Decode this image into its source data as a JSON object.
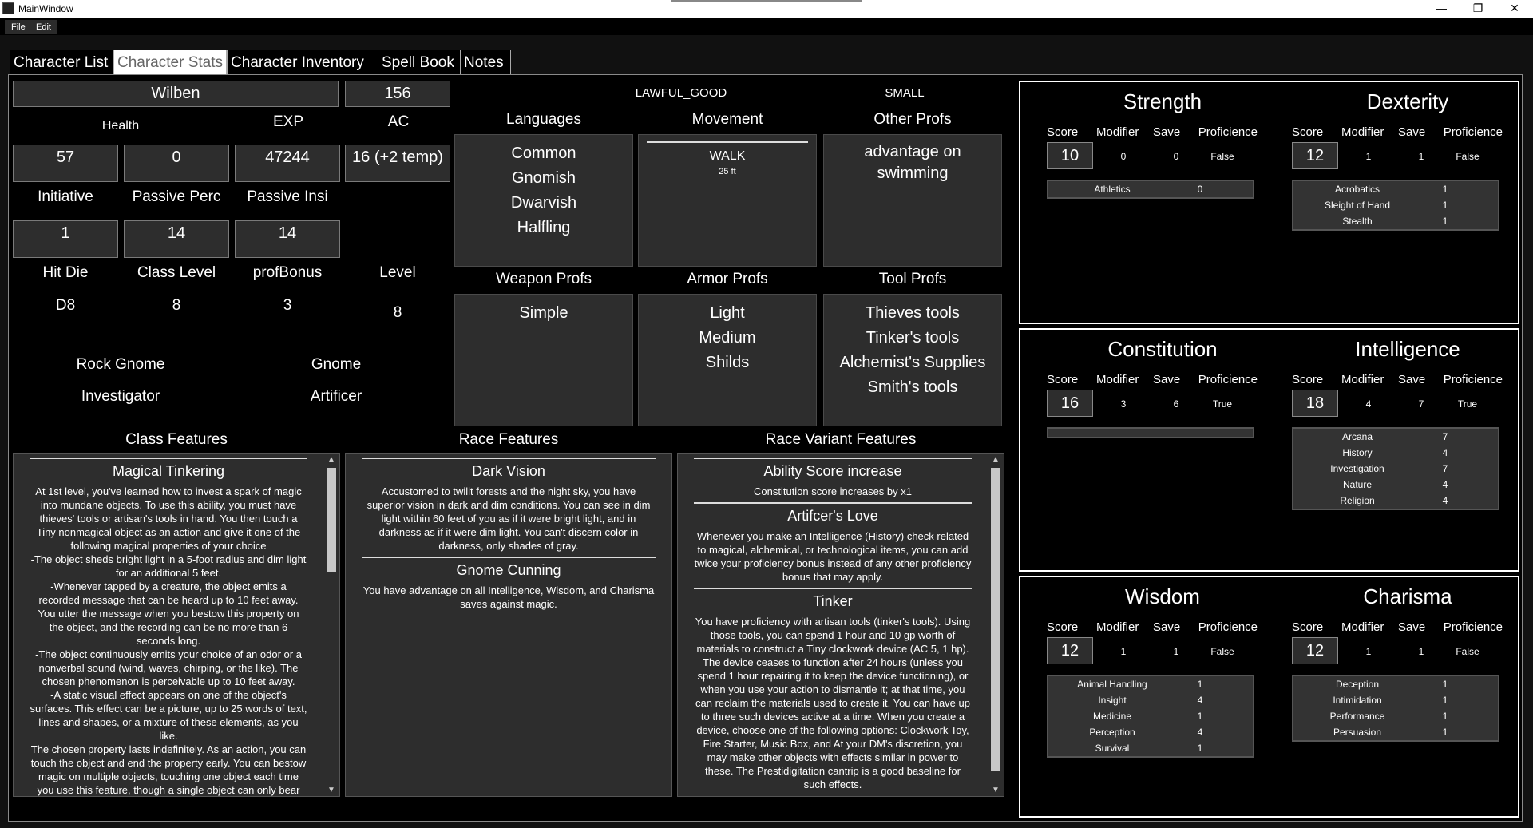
{
  "window": {
    "title": "MainWindow",
    "minimize": "—",
    "restore": "❐",
    "close": "✕"
  },
  "menu": [
    "File",
    "Edit"
  ],
  "tabs": [
    "Character List",
    "Character Stats",
    "Character Inventory",
    "Spell Book",
    "Notes"
  ],
  "active_tab": "Character Stats",
  "character": {
    "name": "Wilben",
    "level_box": "156",
    "labels": {
      "health": "Health",
      "exp": "EXP",
      "ac": "AC",
      "initiative": "Initiative",
      "passive_perc": "Passive Perc",
      "passive_insi": "Passive Insi",
      "hit_die": "Hit Die",
      "class_level": "Class Level",
      "prof_bonus": "profBonus",
      "level": "Level"
    },
    "health": "57",
    "temp": "0",
    "exp": "47244",
    "ac": "16 (+2 temp)",
    "initiative": "1",
    "passive_perc": "14",
    "passive_insi": "14",
    "hit_die": "D8",
    "class_level": "8",
    "prof_bonus": "3",
    "level": "8",
    "subrace": "Rock Gnome",
    "race": "Gnome",
    "subclass": "Investigator",
    "class": "Artificer",
    "alignment": "LAWFUL_GOOD",
    "size": "SMALL"
  },
  "profs": {
    "languages_title": "Languages",
    "languages": [
      "Common",
      "Gnomish",
      "Dwarvish",
      "Halfling"
    ],
    "movement_title": "Movement",
    "movement_type": "WALK",
    "movement_speed": "25 ft",
    "other_title": "Other Profs",
    "other": "advantage on swimming",
    "weapon_title": "Weapon Profs",
    "weapon": [
      "Simple"
    ],
    "armor_title": "Armor Profs",
    "armor": [
      "Light",
      "Medium",
      "Shilds"
    ],
    "tool_title": "Tool Profs",
    "tool": [
      "Thieves tools",
      "Tinker's tools",
      "Alchemist's Supplies",
      "Smith's tools"
    ]
  },
  "features": {
    "class_title": "Class Features",
    "race_title": "Race Features",
    "variant_title": "Race Variant Features",
    "class": [
      {
        "title": "Magical Tinkering",
        "text": "At 1st level, you've learned how to invest a spark of magic into mundane objects. To use this ability, you must have thieves' tools or artisan's tools in hand. You then touch a Tiny nonmagical object as an action and give it one of the following magical properties of your choice\n-The object sheds bright light in a 5-foot radius and dim light for an additional 5 feet.\n-Whenever tapped by a creature, the object emits a recorded message that can be heard up to 10 feet away. You utter the message when you bestow this property on the object, and the recording can be no more than 6 seconds long.\n-The object continuously emits your choice of an odor or a nonverbal sound (wind, waves, chirping, or the like). The chosen phenomenon is perceivable up to 10 feet away.\n-A static visual effect appears on one of the object's surfaces. This effect can be a picture, up to 25 words of text, lines and shapes, or a mixture of these elements, as you like.\nThe chosen property lasts indefinitely. As an action, you can touch the object and end the property early. You can bestow magic on multiple objects, touching one object each time you use this feature, though a single object can only bear one property at a time. The maximum number of objects you can affect with this feature at one time is equal to your Intelligence modifier"
      }
    ],
    "race": [
      {
        "title": "Dark Vision",
        "text": "Accustomed to twilit forests and the night sky, you have superior vision in dark and dim conditions. You can see in dim light within 60 feet of you as if it were bright light, and in darkness as if it were dim light. You can't discern color in darkness, only shades of gray."
      },
      {
        "title": "Gnome Cunning",
        "text": "You have advantage on all Intelligence, Wisdom, and Charisma saves against magic."
      }
    ],
    "variant": [
      {
        "title": "Ability Score increase",
        "text": "Constitution score increases by x1"
      },
      {
        "title": "Artifcer's Love",
        "text": "Whenever you make an Intelligence (History) check related to magical, alchemical, or technological items, you can add twice your proficiency bonus instead of any other proficiency bonus that may apply."
      },
      {
        "title": "Tinker",
        "text": "You have proficiency with artisan tools (tinker's tools). Using those tools, you can spend 1 hour and 10 gp worth of materials to construct a Tiny clockwork device (AC 5, 1 hp). The device ceases to function after 24 hours (unless you spend 1 hour repairing it to keep the device functioning), or when you use your action to dismantle it; at that time, you can reclaim the materials used to create it. You can have up to three such devices active at a time. When you create a device, choose one of the following options: Clockwork Toy, Fire Starter, Music Box, and At your DM's discretion, you may make other objects with effects similar in power to these. The Prestidigitation cantrip is a good baseline for such effects."
      }
    ]
  },
  "stat_headers": {
    "score": "Score",
    "modifier": "Modifier",
    "save": "Save",
    "proficience": "Proficience"
  },
  "stats": [
    {
      "name": "Strength",
      "score": "10",
      "modifier": "0",
      "save": "0",
      "prof": "False",
      "skills": [
        {
          "n": "Athletics",
          "v": "0"
        }
      ]
    },
    {
      "name": "Dexterity",
      "score": "12",
      "modifier": "1",
      "save": "1",
      "prof": "False",
      "skills": [
        {
          "n": "Acrobatics",
          "v": "1"
        },
        {
          "n": "Sleight of Hand",
          "v": "1"
        },
        {
          "n": "Stealth",
          "v": "1"
        }
      ]
    },
    {
      "name": "Constitution",
      "score": "16",
      "modifier": "3",
      "save": "6",
      "prof": "True",
      "skills": []
    },
    {
      "name": "Intelligence",
      "score": "18",
      "modifier": "4",
      "save": "7",
      "prof": "True",
      "skills": [
        {
          "n": "Arcana",
          "v": "7"
        },
        {
          "n": "History",
          "v": "4"
        },
        {
          "n": "Investigation",
          "v": "7"
        },
        {
          "n": "Nature",
          "v": "4"
        },
        {
          "n": "Religion",
          "v": "4"
        }
      ]
    },
    {
      "name": "Wisdom",
      "score": "12",
      "modifier": "1",
      "save": "1",
      "prof": "False",
      "skills": [
        {
          "n": "Animal Handling",
          "v": "1"
        },
        {
          "n": "Insight",
          "v": "4"
        },
        {
          "n": "Medicine",
          "v": "1"
        },
        {
          "n": "Perception",
          "v": "4"
        },
        {
          "n": "Survival",
          "v": "1"
        }
      ]
    },
    {
      "name": "Charisma",
      "score": "12",
      "modifier": "1",
      "save": "1",
      "prof": "False",
      "skills": [
        {
          "n": "Deception",
          "v": "1"
        },
        {
          "n": "Intimidation",
          "v": "1"
        },
        {
          "n": "Performance",
          "v": "1"
        },
        {
          "n": "Persuasion",
          "v": "1"
        }
      ]
    }
  ]
}
